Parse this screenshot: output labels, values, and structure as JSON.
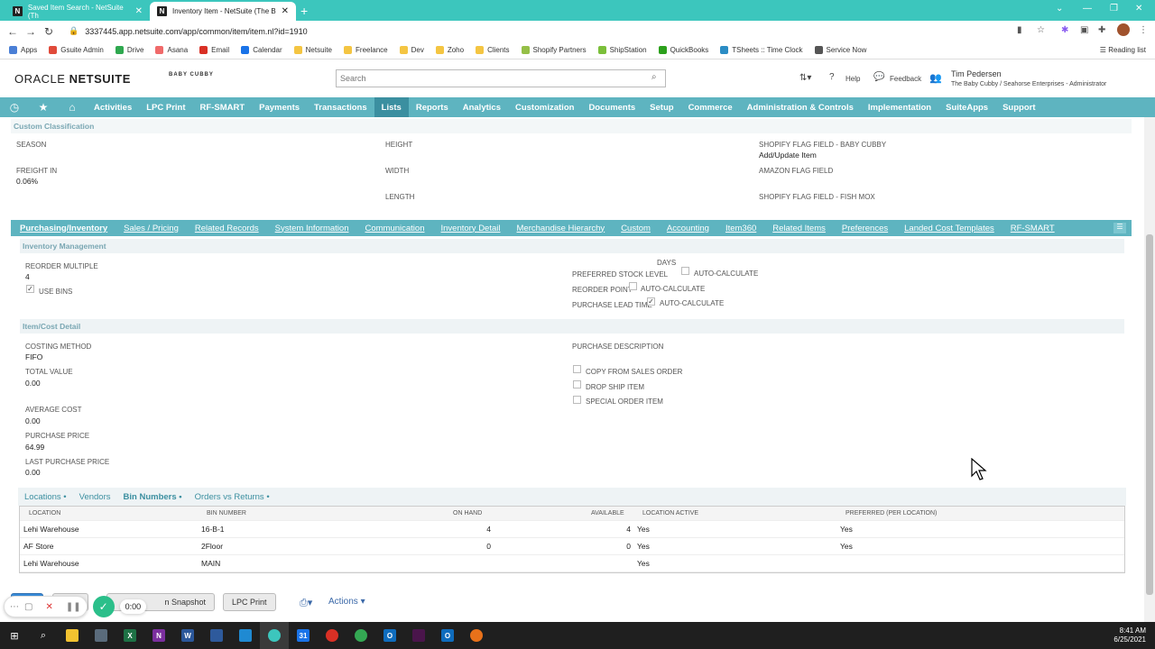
{
  "browser": {
    "tabs": [
      {
        "title": "Saved Item Search - NetSuite (Th"
      },
      {
        "title": "Inventory Item - NetSuite (The B"
      }
    ],
    "url": "3337445.app.netsuite.com/app/common/item/item.nl?id=1910",
    "bookmarks": [
      "Apps",
      "Gsuite Admin",
      "Drive",
      "Asana",
      "Email",
      "Calendar",
      "Netsuite",
      "Freelance",
      "Dev",
      "Zoho",
      "Clients",
      "Shopify Partners",
      "ShipStation",
      "QuickBooks",
      "TSheets :: Time Clock",
      "Service Now"
    ],
    "bookmark_colors": [
      "#4a7fd6",
      "#e04a3a",
      "#2fa84f",
      "#f06a6a",
      "#d93025",
      "#1a73e8",
      "#f4c542",
      "#f4c542",
      "#f4c542",
      "#f4c542",
      "#f4c542",
      "#95bf47",
      "#7bbf3a",
      "#2ca01c",
      "#2b8cc4",
      "#555555"
    ],
    "reading_list": "Reading list"
  },
  "header": {
    "brand_oracle": "ORACLE",
    "brand_netsuite": "NETSUITE",
    "brand_logo": "BABY CUBBY",
    "search_placeholder": "Search",
    "help": "Help",
    "feedback": "Feedback",
    "user_name": "Tim Pedersen",
    "user_role": "The Baby Cubby / Seahorse Enterprises - Administrator"
  },
  "nav": [
    "Activities",
    "LPC Print",
    "RF-SMART",
    "Payments",
    "Transactions",
    "Lists",
    "Reports",
    "Analytics",
    "Customization",
    "Documents",
    "Setup",
    "Commerce",
    "Administration & Controls",
    "Implementation",
    "SuiteApps",
    "Support"
  ],
  "custom_classification": {
    "title": "Custom Classification",
    "season_label": "SEASON",
    "freight_label": "FREIGHT IN",
    "freight_value": "0.06%",
    "height_label": "HEIGHT",
    "width_label": "WIDTH",
    "length_label": "LENGTH",
    "shopify_baby_label": "SHOPIFY FLAG FIELD - BABY CUBBY",
    "shopify_baby_value": "Add/Update Item",
    "amazon_label": "AMAZON FLAG FIELD",
    "shopify_fish_label": "SHOPIFY FLAG FIELD - FISH MOX"
  },
  "subtabs": [
    "Purchasing/Inventory",
    "Sales / Pricing",
    "Related Records",
    "System Information",
    "Communication",
    "Inventory Detail",
    "Merchandise Hierarchy",
    "Custom",
    "Accounting",
    "Item360",
    "Related Items",
    "Preferences",
    "Landed Cost Templates",
    "RF-SMART"
  ],
  "inventory_mgmt": {
    "title": "Inventory Management",
    "reorder_label": "REORDER MULTIPLE",
    "reorder_value": "4",
    "use_bins": "USE BINS",
    "days": "DAYS",
    "pref_stock": "PREFERRED STOCK LEVEL",
    "reorder_point": "REORDER POINT",
    "lead_time": "PURCHASE LEAD TIME",
    "auto_calc": "AUTO-CALCULATE"
  },
  "cost_detail": {
    "title": "Item/Cost Detail",
    "costing_label": "COSTING METHOD",
    "costing_value": "FIFO",
    "total_label": "TOTAL VALUE",
    "total_value": "0.00",
    "avg_label": "AVERAGE COST",
    "avg_value": "0.00",
    "purchase_label": "PURCHASE PRICE",
    "purchase_value": "64.99",
    "last_label": "LAST PURCHASE PRICE",
    "last_value": "0.00",
    "desc_label": "PURCHASE DESCRIPTION",
    "copy_sales": "COPY FROM SALES ORDER",
    "drop_ship": "DROP SHIP ITEM",
    "special_order": "SPECIAL ORDER ITEM"
  },
  "inner_tabs": [
    "Locations •",
    "Vendors",
    "Bin Numbers •",
    "Orders vs Returns •"
  ],
  "bin_table": {
    "headers": [
      "LOCATION",
      "BIN NUMBER",
      "ON HAND",
      "AVAILABLE",
      "LOCATION ACTIVE",
      "PREFERRED (PER LOCATION)"
    ],
    "rows": [
      [
        "Lehi Warehouse",
        "16-B-1",
        "4",
        "4",
        "Yes",
        "Yes"
      ],
      [
        "AF Store",
        "2Floor",
        "0",
        "0",
        "Yes",
        "Yes"
      ],
      [
        "Lehi Warehouse",
        "MAIN",
        "",
        "",
        "Yes",
        ""
      ]
    ]
  },
  "buttons": {
    "snapshot": "n Snapshot",
    "lpc_print": "LPC Print",
    "actions": "Actions ▾"
  },
  "recorder": {
    "time": "0:00"
  },
  "taskbar": {
    "time": "8:41 AM",
    "date": "6/25/2021"
  }
}
